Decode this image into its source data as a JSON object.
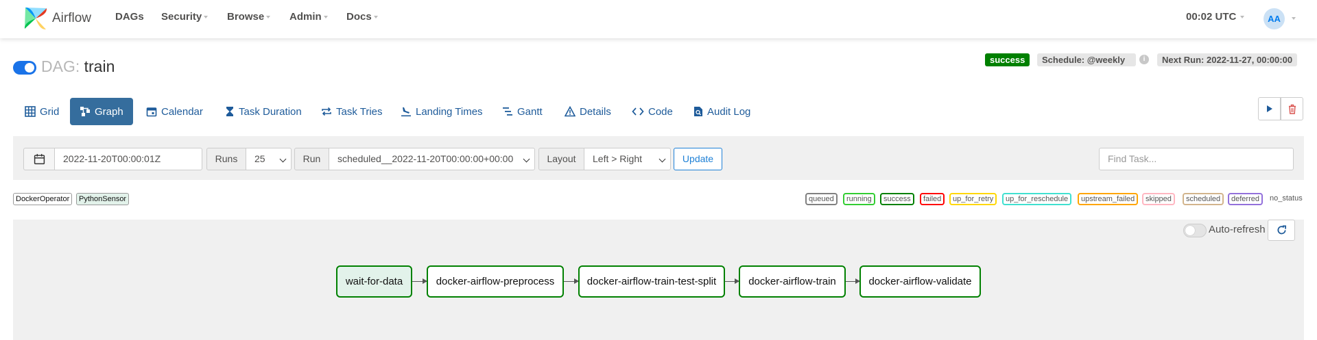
{
  "app": {
    "brand": "Airflow"
  },
  "nav": {
    "items": [
      {
        "label": "DAGs"
      },
      {
        "label": "Security"
      },
      {
        "label": "Browse"
      },
      {
        "label": "Admin"
      },
      {
        "label": "Docs"
      }
    ],
    "clock": "00:02 UTC",
    "user_initials": "AA"
  },
  "dag": {
    "prefix": "DAG:",
    "name": "train",
    "enabled": true,
    "status": "success",
    "schedule": "Schedule: @weekly",
    "info_icon": "i",
    "next_run": "Next Run: 2022-11-27, 00:00:00"
  },
  "tabs": [
    {
      "label": "Grid",
      "icon": "grid-icon"
    },
    {
      "label": "Graph",
      "icon": "graph-icon",
      "active": true
    },
    {
      "label": "Calendar",
      "icon": "calendar-icon"
    },
    {
      "label": "Task Duration",
      "icon": "hourglass-icon"
    },
    {
      "label": "Task Tries",
      "icon": "repeat-icon"
    },
    {
      "label": "Landing Times",
      "icon": "landing-icon"
    },
    {
      "label": "Gantt",
      "icon": "gantt-icon"
    },
    {
      "label": "Details",
      "icon": "warning-icon"
    },
    {
      "label": "Code",
      "icon": "code-icon"
    },
    {
      "label": "Audit Log",
      "icon": "audit-log-icon"
    }
  ],
  "controls": {
    "base_date": "2022-11-20T00:00:01Z",
    "runs_label": "Runs",
    "runs_value": "25",
    "run_label": "Run",
    "run_value": "scheduled__2022-11-20T00:00:00+00:00",
    "layout_label": "Layout",
    "layout_value": "Left > Right",
    "update_label": "Update",
    "find_placeholder": "Find Task..."
  },
  "operators": [
    {
      "label": "DockerOperator",
      "color": "#ffffff"
    },
    {
      "label": "PythonSensor",
      "color": "#e2f2ea"
    }
  ],
  "states": [
    {
      "label": "queued",
      "color": "#808080"
    },
    {
      "label": "running",
      "color": "#32cd32"
    },
    {
      "label": "success",
      "color": "#008000"
    },
    {
      "label": "failed",
      "color": "#ff0000"
    },
    {
      "label": "up_for_retry",
      "color": "#ffd700"
    },
    {
      "label": "up_for_reschedule",
      "color": "#40e0d0"
    },
    {
      "label": "upstream_failed",
      "color": "#ffa500"
    },
    {
      "label": "skipped",
      "color": "#ffb6c1"
    },
    {
      "label": "scheduled",
      "color": "#d2b48c"
    },
    {
      "label": "deferred",
      "color": "#9370db"
    }
  ],
  "no_status_label": "no_status",
  "graph": {
    "auto_refresh_label": "Auto-refresh",
    "auto_refresh_on": false,
    "nodes": [
      {
        "label": "wait-for-data",
        "state": "success",
        "operator": "PythonSensor"
      },
      {
        "label": "docker-airflow-preprocess",
        "state": "success",
        "operator": "DockerOperator"
      },
      {
        "label": "docker-airflow-train-test-split",
        "state": "success",
        "operator": "DockerOperator"
      },
      {
        "label": "docker-airflow-train",
        "state": "success",
        "operator": "DockerOperator"
      },
      {
        "label": "docker-airflow-validate",
        "state": "success",
        "operator": "DockerOperator"
      }
    ]
  },
  "colors": {
    "accent": "#017cee",
    "tab_active": "#356d9d",
    "success": "#008000",
    "delete_red": "#d9534f"
  }
}
